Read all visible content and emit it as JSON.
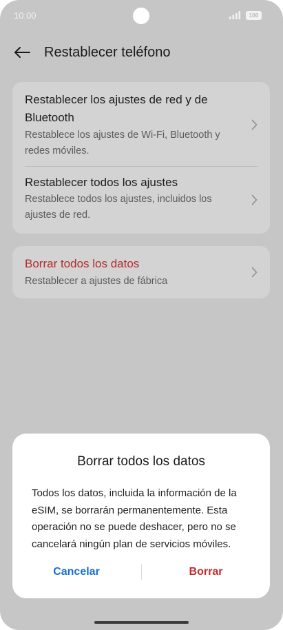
{
  "status_bar": {
    "time": "10:00",
    "battery": "100",
    "signal_icon": "signal-icon"
  },
  "header": {
    "title": "Restablecer teléfono",
    "back_icon": "arrow-left-icon"
  },
  "reset_options": [
    {
      "title": "Restablecer los ajustes de red y de Bluetooth",
      "subtitle": "Restablece los ajustes de Wi-Fi, Bluetooth y redes móviles."
    },
    {
      "title": "Restablecer todos los ajustes",
      "subtitle": "Restablece todos los ajustes, incluidos los ajustes de red."
    }
  ],
  "erase_option": {
    "title": "Borrar todos los datos",
    "subtitle": "Restablecer a ajustes de fábrica",
    "title_color": "#b52a2a"
  },
  "dialog": {
    "title": "Borrar todos los datos",
    "message": "Todos los datos, incluida la información de la eSIM, se borrarán permanentemente. Esta operación no se puede deshacer, pero no se cancelará ningún plan de servicios móviles.",
    "cancel_label": "Cancelar",
    "confirm_label": "Borrar",
    "cancel_color": "#1a6fd1",
    "confirm_color": "#c62b2b"
  },
  "colors": {
    "overlay_background": "#c6c6c6",
    "card_background": "#d3d3d3",
    "dialog_background": "#ffffff"
  }
}
